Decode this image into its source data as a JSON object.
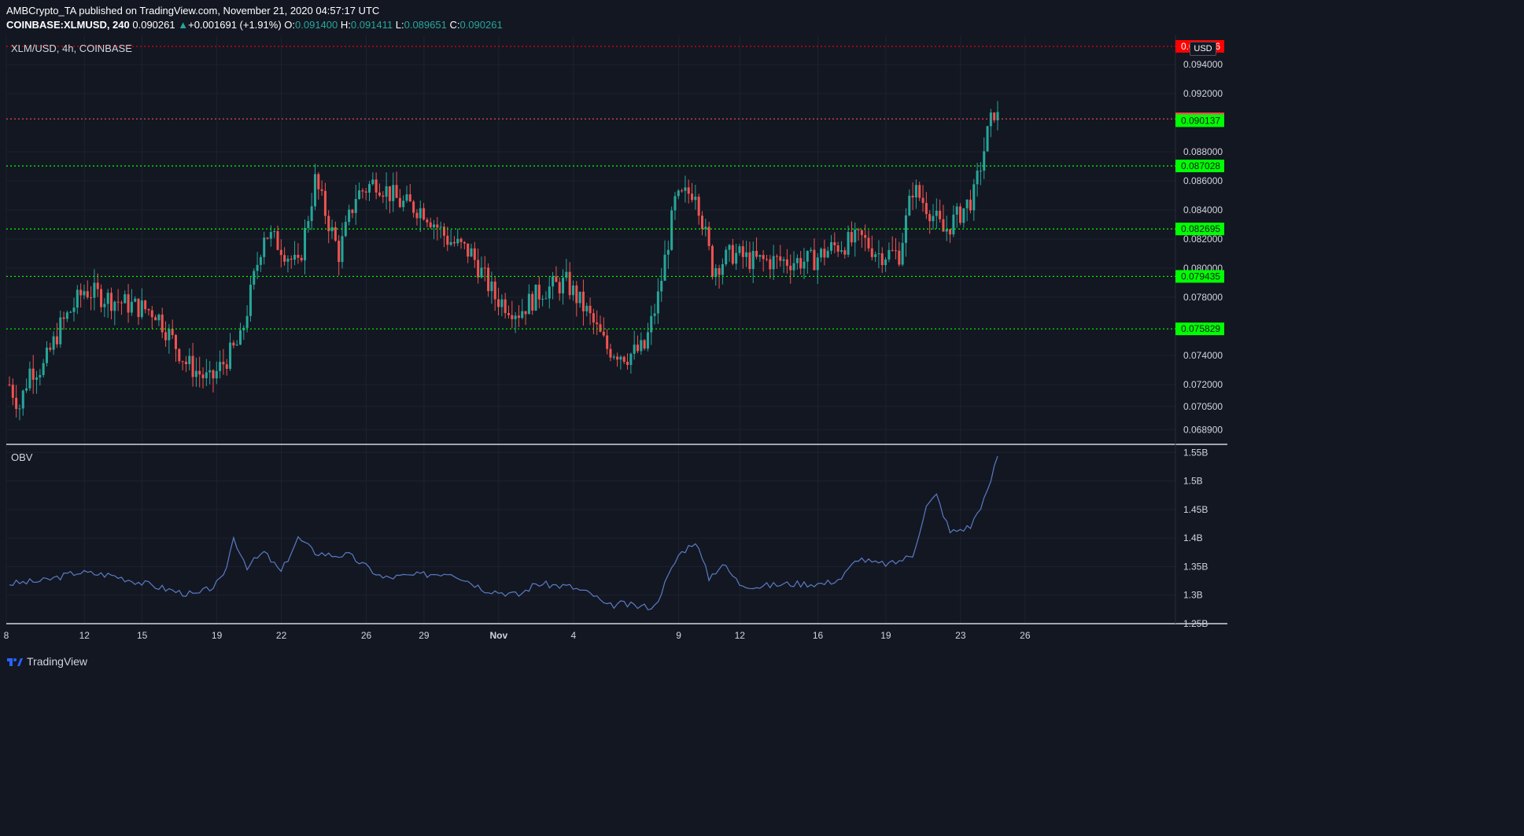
{
  "header": {
    "line1": "AMBCrypto_TA published on TradingView.com, November 21, 2020 04:57:17 UTC",
    "symbol": "COINBASE:XLMUSD, 240",
    "last": "0.090261",
    "change": "+0.001691 (+1.91%)",
    "o_label": "O:",
    "o_value": "0.091400",
    "h_label": "H:",
    "h_value": "0.091411",
    "l_label": "L:",
    "l_value": "0.089651",
    "c_label": "C:",
    "c_value": "0.090261"
  },
  "pane_title": "XLM/USD, 4h, COINBASE",
  "obv_title": "OBV",
  "currency": "USD",
  "brand": "TradingView",
  "colors": {
    "background": "#131722",
    "up": "#26a69a",
    "down": "#ef5350",
    "support": "#00ff00",
    "resistance": "#ff0000",
    "obv": "#5b7bc4",
    "grid": "#1e2230"
  },
  "chart_data": [
    {
      "type": "candlestick",
      "title": "XLM/USD, 4h, COINBASE",
      "ylim": [
        0.068,
        0.096
      ],
      "y_ticks": [
        "0.094000",
        "0.092000",
        "0.088000",
        "0.086000",
        "0.084000",
        "0.082000",
        "0.080000",
        "0.078000",
        "0.074000",
        "0.072000",
        "0.070500",
        "0.068900"
      ],
      "x_ticks": [
        "8",
        "12",
        "15",
        "19",
        "22",
        "26",
        "29",
        "Nov",
        "4",
        "9",
        "12",
        "16",
        "19",
        "23",
        "26"
      ],
      "horizontal_levels": [
        {
          "value": 0.095246,
          "label": "0.095246",
          "color": "#ff0000",
          "style": "dotted"
        },
        {
          "value": 0.090261,
          "label": "0.090261",
          "color": "#ef5350",
          "style": "dotted"
        },
        {
          "value": 0.090137,
          "label": "0.090137",
          "color": "#00ff00",
          "style": "label-only"
        },
        {
          "value": 0.087028,
          "label": "0.087028",
          "color": "#00ff00",
          "style": "dotted"
        },
        {
          "value": 0.082695,
          "label": "0.082695",
          "color": "#00ff00",
          "style": "dotted"
        },
        {
          "value": 0.079435,
          "label": "0.079435",
          "color": "#00ff00",
          "style": "dotted"
        },
        {
          "value": 0.075829,
          "label": "0.075829",
          "color": "#00ff00",
          "style": "dotted"
        }
      ],
      "close_path": [
        [
          0,
          0.072
        ],
        [
          3,
          0.0705
        ],
        [
          6,
          0.073
        ],
        [
          10,
          0.0732
        ],
        [
          15,
          0.076
        ],
        [
          22,
          0.0785
        ],
        [
          28,
          0.078
        ],
        [
          35,
          0.0775
        ],
        [
          43,
          0.077
        ],
        [
          52,
          0.0735
        ],
        [
          59,
          0.0722
        ],
        [
          64,
          0.0738
        ],
        [
          68,
          0.075
        ],
        [
          75,
          0.0825
        ],
        [
          80,
          0.0815
        ],
        [
          85,
          0.08
        ],
        [
          90,
          0.086
        ],
        [
          97,
          0.081
        ],
        [
          102,
          0.085
        ],
        [
          108,
          0.086
        ],
        [
          115,
          0.0845
        ],
        [
          122,
          0.084
        ],
        [
          129,
          0.082
        ],
        [
          136,
          0.081
        ],
        [
          143,
          0.078
        ],
        [
          150,
          0.077
        ],
        [
          157,
          0.0785
        ],
        [
          164,
          0.079
        ],
        [
          170,
          0.077
        ],
        [
          176,
          0.0745
        ],
        [
          182,
          0.074
        ],
        [
          187,
          0.0745
        ],
        [
          191,
          0.078
        ],
        [
          196,
          0.0845
        ],
        [
          202,
          0.0855
        ],
        [
          207,
          0.08
        ],
        [
          213,
          0.081
        ],
        [
          219,
          0.0805
        ],
        [
          227,
          0.0805
        ],
        [
          236,
          0.0805
        ],
        [
          243,
          0.0815
        ],
        [
          251,
          0.082
        ],
        [
          256,
          0.081
        ],
        [
          262,
          0.081
        ],
        [
          266,
          0.0855
        ],
        [
          271,
          0.084
        ],
        [
          275,
          0.0825
        ],
        [
          279,
          0.0835
        ],
        [
          284,
          0.085
        ],
        [
          288,
          0.0892
        ],
        [
          290,
          0.0908
        ],
        [
          291,
          0.0903
        ]
      ],
      "n_candles": 292
    },
    {
      "type": "line",
      "title": "OBV",
      "ylim": [
        1.25,
        1.56
      ],
      "y_ticks": [
        "1.55B",
        "1.5B",
        "1.45B",
        "1.4B",
        "1.35B",
        "1.3B",
        "1.25B"
      ],
      "points": [
        [
          0,
          1.32
        ],
        [
          10,
          1.325
        ],
        [
          20,
          1.34
        ],
        [
          30,
          1.335
        ],
        [
          40,
          1.32
        ],
        [
          50,
          1.305
        ],
        [
          55,
          1.3
        ],
        [
          60,
          1.315
        ],
        [
          63,
          1.33
        ],
        [
          66,
          1.4
        ],
        [
          70,
          1.35
        ],
        [
          75,
          1.375
        ],
        [
          80,
          1.34
        ],
        [
          85,
          1.4
        ],
        [
          90,
          1.375
        ],
        [
          95,
          1.37
        ],
        [
          100,
          1.37
        ],
        [
          105,
          1.35
        ],
        [
          110,
          1.33
        ],
        [
          120,
          1.335
        ],
        [
          130,
          1.34
        ],
        [
          140,
          1.31
        ],
        [
          150,
          1.3
        ],
        [
          155,
          1.32
        ],
        [
          165,
          1.315
        ],
        [
          172,
          1.3
        ],
        [
          176,
          1.28
        ],
        [
          180,
          1.285
        ],
        [
          185,
          1.28
        ],
        [
          190,
          1.28
        ],
        [
          193,
          1.32
        ],
        [
          197,
          1.37
        ],
        [
          202,
          1.395
        ],
        [
          206,
          1.33
        ],
        [
          210,
          1.355
        ],
        [
          215,
          1.32
        ],
        [
          220,
          1.315
        ],
        [
          230,
          1.32
        ],
        [
          240,
          1.32
        ],
        [
          245,
          1.33
        ],
        [
          250,
          1.365
        ],
        [
          255,
          1.355
        ],
        [
          260,
          1.355
        ],
        [
          266,
          1.37
        ],
        [
          270,
          1.455
        ],
        [
          273,
          1.475
        ],
        [
          277,
          1.41
        ],
        [
          283,
          1.42
        ],
        [
          288,
          1.48
        ],
        [
          291,
          1.545
        ]
      ]
    }
  ]
}
